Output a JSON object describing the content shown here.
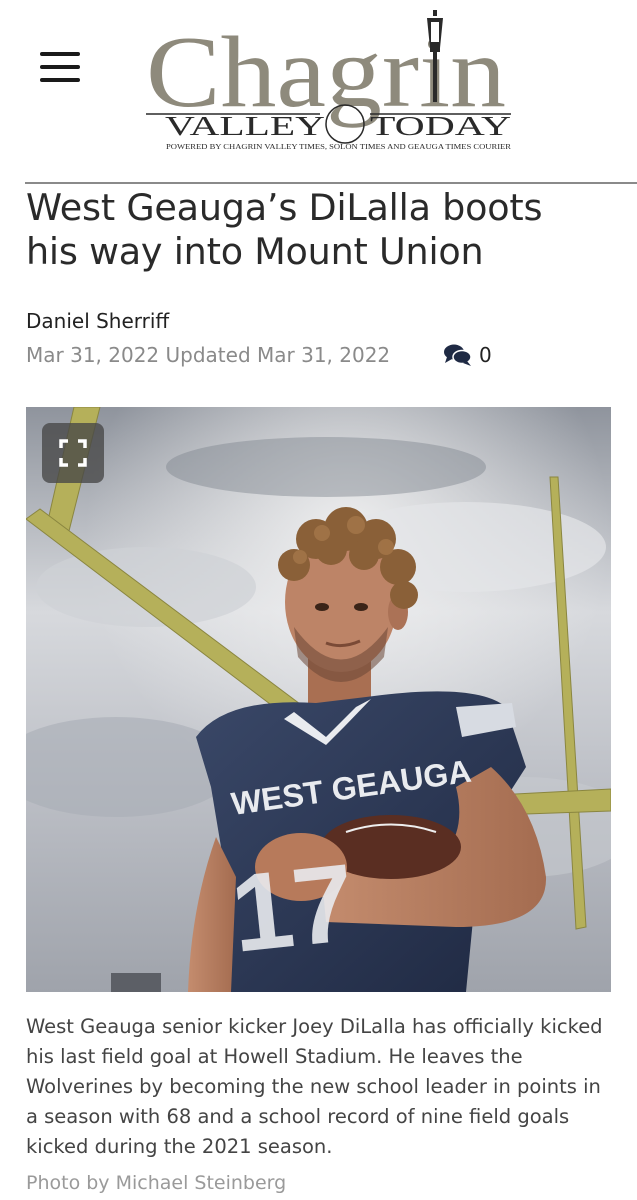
{
  "header": {
    "logo": {
      "main": "Chagrin",
      "left_word": "VALLEY",
      "right_word": "TODAY",
      "tagline": "POWERED BY CHAGRIN VALLEY TIMES, SOLON TIMES AND GEAUGA TIMES COURIER"
    },
    "menu_icon": "hamburger-menu-icon"
  },
  "article": {
    "headline_line1": "West Geauga’s DiLalla boots",
    "headline_line2": "his way into Mount Union",
    "author": "Daniel Sherriff",
    "dates": "Mar 31, 2022 Updated Mar 31, 2022",
    "comment_icon": "comments-icon",
    "comment_count": "0",
    "photo": {
      "alt": "West Geauga senior kicker Joey DiLalla",
      "jersey_text": "WEST GEAUGA",
      "jersey_number": "17",
      "expand_icon": "expand-icon"
    },
    "caption": "West Geauga senior kicker Joey DiLalla has officially kicked his last field goal at Howell Stadium. He leaves the Wolverines by becoming the new school leader in points in a season with 68 and a school record of nine field goals kicked during the 2021 season.",
    "credit": "Photo by Michael Steinberg"
  },
  "colors": {
    "logo": "#8e8a7c",
    "goalpost": "#b5b05a",
    "jersey": "#2f3a55",
    "sky": "#b9bcc3"
  }
}
